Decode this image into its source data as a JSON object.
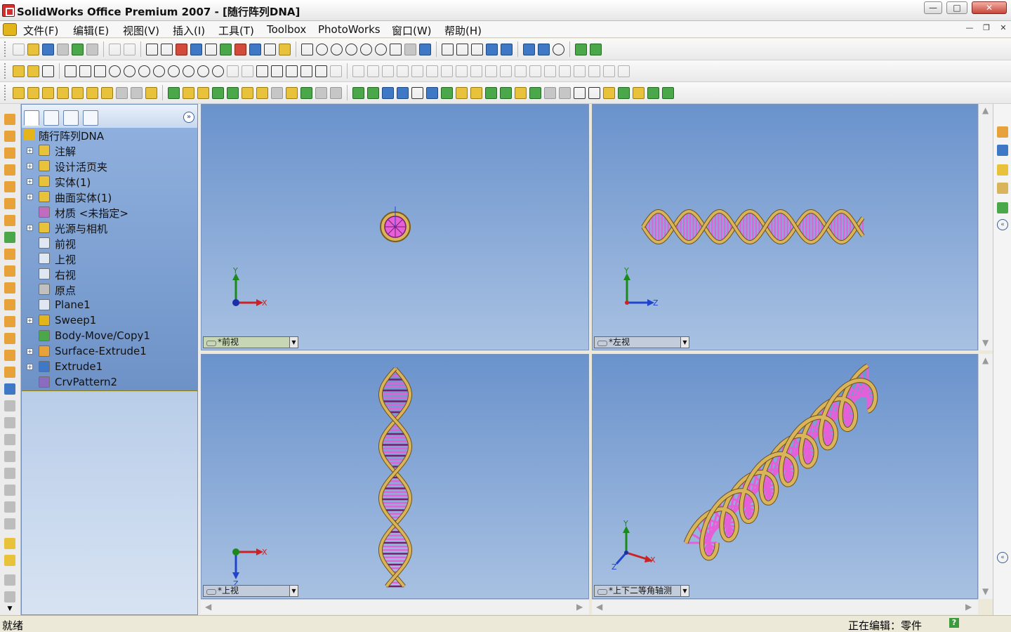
{
  "window": {
    "title": "SolidWorks Office Premium 2007 - [随行阵列DNA]",
    "minimize": "—",
    "maximize": "□",
    "close": "✕"
  },
  "menu": {
    "items": [
      "文件(F)",
      "编辑(E)",
      "视图(V)",
      "插入(I)",
      "工具(T)",
      "Toolbox",
      "PhotoWorks",
      "窗口(W)",
      "帮助(H)"
    ],
    "mdi_minimize": "—",
    "mdi_restore": "❐",
    "mdi_close": "✕"
  },
  "feature_manager": {
    "root": "随行阵列DNA",
    "expand_label": "»",
    "items": [
      {
        "label": "注解",
        "expandable": true,
        "icon": "annotation-icon"
      },
      {
        "label": "设计活页夹",
        "expandable": true,
        "icon": "design-binder-icon"
      },
      {
        "label": "实体(1)",
        "expandable": true,
        "icon": "solid-body-folder-icon"
      },
      {
        "label": "曲面实体(1)",
        "expandable": true,
        "icon": "surface-body-folder-icon"
      },
      {
        "label": "材质 <未指定>",
        "expandable": false,
        "icon": "material-icon"
      },
      {
        "label": "光源与相机",
        "expandable": true,
        "icon": "lights-cameras-icon"
      },
      {
        "label": "前视",
        "expandable": false,
        "icon": "plane-icon"
      },
      {
        "label": "上视",
        "expandable": false,
        "icon": "plane-icon"
      },
      {
        "label": "右视",
        "expandable": false,
        "icon": "plane-icon"
      },
      {
        "label": "原点",
        "expandable": false,
        "icon": "origin-icon"
      },
      {
        "label": "Plane1",
        "expandable": false,
        "icon": "plane-icon"
      },
      {
        "label": "Sweep1",
        "expandable": true,
        "icon": "sweep-icon"
      },
      {
        "label": "Body-Move/Copy1",
        "expandable": false,
        "icon": "move-copy-icon"
      },
      {
        "label": "Surface-Extrude1",
        "expandable": true,
        "icon": "surface-extrude-icon"
      },
      {
        "label": "Extrude1",
        "expandable": true,
        "icon": "extrude-icon"
      },
      {
        "label": "CrvPattern2",
        "expandable": false,
        "icon": "curve-pattern-icon"
      }
    ]
  },
  "viewports": {
    "front": {
      "label": "*前视",
      "axes": [
        "Y",
        "X"
      ]
    },
    "left": {
      "label": "*左视",
      "axes": [
        "Y",
        "Z"
      ]
    },
    "top": {
      "label": "*上视",
      "axes": [
        "X",
        "Z"
      ]
    },
    "dimetric": {
      "label": "*上下二等角轴测",
      "axes": [
        "Y",
        "X",
        "Z"
      ]
    }
  },
  "statusbar": {
    "left": "就绪",
    "right": "正在编辑：零件",
    "help": "?"
  },
  "colors": {
    "viewport_top": "#6a92cc",
    "viewport_bottom": "#a8c1e2",
    "dna_backbone": "#d9b45b",
    "dna_rungs": "#e45fd8",
    "tree_bg": "#7fa2d6",
    "feature_end_bar": "#e5d414"
  }
}
